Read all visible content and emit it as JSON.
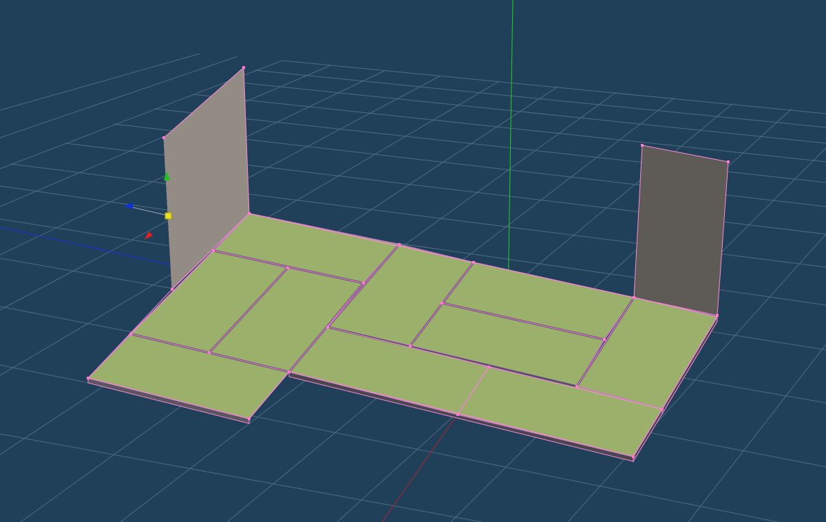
{
  "viewport": {
    "colors": {
      "background": "#20405a",
      "grid": "#4f6b80",
      "floor_top": "#9bb06a",
      "floor_side": "#5a5560",
      "selection_edge": "#ff8ad8",
      "vertex": "#ff79d0",
      "wall_left": "#938c84",
      "wall_right": "#5e5a55",
      "axis_x": "#e0202a",
      "axis_y": "#22d022",
      "axis_z": "#1a30e0"
    },
    "gizmo": {
      "icons": [
        "move-y-arrow-icon",
        "move-x-arrow-icon",
        "move-z-arrow-icon",
        "gizmo-center-handle-icon"
      ]
    }
  }
}
